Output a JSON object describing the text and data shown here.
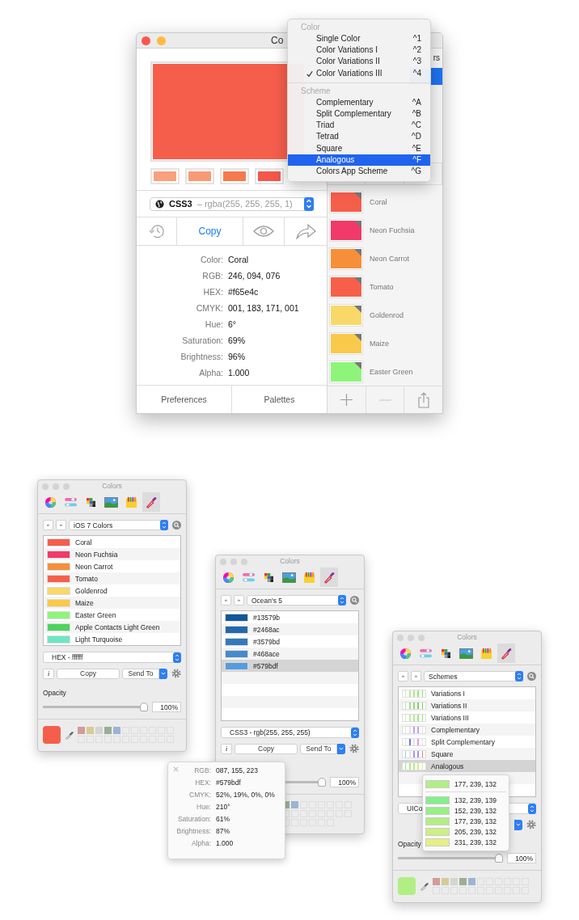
{
  "main_window": {
    "title": "Co",
    "side_label": "rs",
    "variations": [
      {
        "color": "#f9a07c"
      },
      {
        "color": "#f99a74"
      },
      {
        "color": "#f77a4e"
      },
      {
        "color": "#f5574a"
      }
    ],
    "format": {
      "name": "CSS3",
      "value": "– rgba(255, 255, 255, 1)"
    },
    "copy": "Copy",
    "info": [
      {
        "label": "Color:",
        "value": "Coral"
      },
      {
        "label": "RGB:",
        "value": "246, 094, 076"
      },
      {
        "label": "HEX:",
        "value": "#f65e4c"
      },
      {
        "label": "CMYK:",
        "value": "001, 183, 171, 001"
      },
      {
        "label": "Hue:",
        "value": "6°"
      },
      {
        "label": "Saturation:",
        "value": "69%"
      },
      {
        "label": "Brightness:",
        "value": "96%"
      },
      {
        "label": "Alpha:",
        "value": "1.000"
      }
    ],
    "footer": [
      "Preferences",
      "Palettes"
    ],
    "palette": [
      {
        "name": "Coral",
        "color": "#f65e4c"
      },
      {
        "name": "Neon Fuchsia",
        "color": "#f23a6a"
      },
      {
        "name": "Neon Carrot",
        "color": "#f78f3a"
      },
      {
        "name": "Tomato",
        "color": "#f6604a"
      },
      {
        "name": "Goldenrod",
        "color": "#f8d868"
      },
      {
        "name": "Maize",
        "color": "#f9c94c"
      },
      {
        "name": "Easter Green",
        "color": "#8ef57a"
      }
    ]
  },
  "menu": {
    "sections": [
      {
        "header": "Color",
        "items": [
          {
            "label": "Single Color",
            "shortcut": "^1",
            "checked": false,
            "selected": false
          },
          {
            "label": "Color Variations I",
            "shortcut": "^2",
            "checked": false,
            "selected": false
          },
          {
            "label": "Color Variations II",
            "shortcut": "^3",
            "checked": false,
            "selected": false
          },
          {
            "label": "Color Variations III",
            "shortcut": "^4",
            "checked": true,
            "selected": false
          }
        ]
      },
      {
        "header": "Scheme",
        "items": [
          {
            "label": "Complementary",
            "shortcut": "^A",
            "checked": false,
            "selected": false
          },
          {
            "label": "Split Complementary",
            "shortcut": "^B",
            "checked": false,
            "selected": false
          },
          {
            "label": "Triad",
            "shortcut": "^C",
            "checked": false,
            "selected": false
          },
          {
            "label": "Tetrad",
            "shortcut": "^D",
            "checked": false,
            "selected": false
          },
          {
            "label": "Square",
            "shortcut": "^E",
            "checked": false,
            "selected": false
          },
          {
            "label": "Analogous",
            "shortcut": "^F",
            "checked": false,
            "selected": true
          },
          {
            "label": "Colors App Scheme",
            "shortcut": "^G",
            "checked": false,
            "selected": false
          }
        ]
      }
    ]
  },
  "palette_windows": [
    {
      "title": "Colors",
      "tabs": [
        {
          "selected": false
        },
        {
          "selected": false
        },
        {
          "selected": false
        },
        {
          "selected": false
        },
        {
          "selected": false
        },
        {
          "selected": true
        }
      ],
      "nav": [
        "«",
        "»"
      ],
      "source": "iOS 7 Colors",
      "items": [
        {
          "name": "Coral",
          "color": "#f65e4c",
          "selected": false
        },
        {
          "name": "Neon Fuchsia",
          "color": "#f23a6a",
          "selected": false
        },
        {
          "name": "Neon Carrot",
          "color": "#f78f3a",
          "selected": false
        },
        {
          "name": "Tomato",
          "color": "#f6604a",
          "selected": false
        },
        {
          "name": "Goldenrod",
          "color": "#f8d868",
          "selected": false
        },
        {
          "name": "Maize",
          "color": "#f9c94c",
          "selected": false
        },
        {
          "name": "Easter Green",
          "color": "#8ef57a",
          "selected": false
        },
        {
          "name": "Apple Contacts Light Green",
          "color": "#4cd45c",
          "selected": false
        },
        {
          "name": "Light Turquoise",
          "color": "#6ee6c4",
          "selected": false
        }
      ],
      "format": "HEX - ffffff",
      "info_button": "i",
      "copy": "Copy",
      "send": "Send To",
      "opacity": {
        "label": "Opacity",
        "level": 1,
        "value": "100%"
      },
      "current": {
        "color": "#f65e4c"
      },
      "favorites": [
        {
          "color": "#d49a9a"
        },
        {
          "color": "#d4cc94"
        },
        {
          "color": "#d4d4d4"
        },
        {
          "color": "#9cae94"
        },
        {
          "color": "#9cb4d4"
        }
      ]
    },
    {
      "title": "Colors",
      "tabs": [
        {
          "selected": false
        },
        {
          "selected": false
        },
        {
          "selected": false
        },
        {
          "selected": false
        },
        {
          "selected": false
        },
        {
          "selected": true
        }
      ],
      "nav": [
        "«",
        "»"
      ],
      "source": "Ocean's 5",
      "items": [
        {
          "name": "#13579b",
          "color": "#13579b",
          "selected": false
        },
        {
          "name": "#2468ac",
          "color": "#2468ac",
          "selected": false
        },
        {
          "name": "#3579bd",
          "color": "#3579bd",
          "selected": false
        },
        {
          "name": "#468ace",
          "color": "#468ace",
          "selected": false
        },
        {
          "name": "#579bdf",
          "color": "#579bdf",
          "selected": true
        }
      ],
      "format": "CSS3 - rgb(255, 255, 255)",
      "info_button": "i",
      "copy": "Copy",
      "send": "Send To",
      "opacity": {
        "level": 1,
        "value": "100%"
      },
      "favorites": [
        {
          "color": "#9cae94"
        },
        {
          "color": "#9cb4d4"
        }
      ],
      "popover": {
        "kind": "info",
        "rows": [
          {
            "label": "RGB:",
            "value": "087, 155, 223"
          },
          {
            "label": "HEX:",
            "value": "#579bdf"
          },
          {
            "label": "CMYK:",
            "value": "52%, 19%, 0%, 0%"
          },
          {
            "label": "Hue:",
            "value": "210°"
          },
          {
            "label": "Saturation:",
            "value": "61%"
          },
          {
            "label": "Brightness:",
            "value": "87%"
          },
          {
            "label": "Alpha:",
            "value": "1.000"
          }
        ]
      }
    },
    {
      "title": "Colors",
      "tabs": [
        {
          "selected": false
        },
        {
          "selected": false
        },
        {
          "selected": false
        },
        {
          "selected": false
        },
        {
          "selected": false
        },
        {
          "selected": true
        }
      ],
      "nav": [
        "«",
        "»"
      ],
      "source": "Schemes",
      "items": [
        {
          "name": "Variations I",
          "kind": "scheme",
          "stripes": [
            {
              "color": "#c8f0aa"
            },
            {
              "color": "#b8ec9a"
            },
            {
              "color": "#a8e88a"
            },
            {
              "color": "#98e47c"
            },
            {
              "color": "#88e06c"
            }
          ],
          "selected": false
        },
        {
          "name": "Variations II",
          "kind": "scheme",
          "stripes": [
            {
              "color": "#b0e898"
            },
            {
              "color": "#a0e088"
            },
            {
              "color": "#90d878"
            },
            {
              "color": "#80d068"
            },
            {
              "color": "#70c858"
            }
          ],
          "selected": false
        },
        {
          "name": "Variations III",
          "kind": "scheme",
          "stripes": [
            {
              "color": "#d0f4b8"
            },
            {
              "color": "#c0f0a8"
            },
            {
              "color": "#b0ec98"
            },
            {
              "color": "#a0e888"
            },
            {
              "color": "#90e478"
            }
          ],
          "selected": false
        },
        {
          "name": "Complementary",
          "kind": "scheme",
          "stripes": [
            {
              "color": "#e4e4e4"
            },
            {
              "color": "#e4e4e4"
            },
            {
              "color": "#c49ef0"
            },
            {
              "color": "#c49ef0"
            },
            {
              "color": "#e4e4e4"
            }
          ],
          "selected": false
        },
        {
          "name": "Split Complementary",
          "kind": "scheme",
          "stripes": [
            {
              "color": "#e4e4e4"
            },
            {
              "color": "#6a7ce8"
            },
            {
              "color": "#e4e4e4"
            },
            {
              "color": "#e89ae0"
            },
            {
              "color": "#e4e4e4"
            }
          ],
          "selected": false
        },
        {
          "name": "Square",
          "kind": "scheme",
          "stripes": [
            {
              "color": "#7ad8e8"
            },
            {
              "color": "#e4e4e4"
            },
            {
              "color": "#b08ef0"
            },
            {
              "color": "#b08ef0"
            },
            {
              "color": "#e87a7a"
            }
          ],
          "selected": false
        },
        {
          "name": "Analogous",
          "kind": "scheme",
          "stripes": [
            {
              "color": "#90e890"
            },
            {
              "color": "#a8ec88"
            },
            {
              "color": "#b8ec88"
            },
            {
              "color": "#d0ee88"
            },
            {
              "color": "#e0ee88"
            }
          ],
          "selected": true
        }
      ],
      "format": "UICo",
      "opacity": {
        "label": "Opacity",
        "level": 1,
        "value": "100%"
      },
      "current": {
        "color": "#b1ef84"
      },
      "favorites": [
        {
          "color": "#d49a9a"
        },
        {
          "color": "#d4cc94"
        },
        {
          "color": "#d4d4d4"
        },
        {
          "color": "#9cae94"
        },
        {
          "color": "#9cb4d4"
        }
      ],
      "popover": {
        "kind": "scheme",
        "rows": [
          {
            "value": "177, 239, 132",
            "color": "#b1ef84"
          },
          {
            "value": "132, 239, 139",
            "color": "#84ef8b"
          },
          {
            "value": "152, 239, 132",
            "color": "#98ef84"
          },
          {
            "value": "177, 239, 132",
            "color": "#b1ef84"
          },
          {
            "value": "205, 239, 132",
            "color": "#cdef84"
          },
          {
            "value": "231, 239, 132",
            "color": "#e7ef84"
          }
        ]
      }
    }
  ]
}
